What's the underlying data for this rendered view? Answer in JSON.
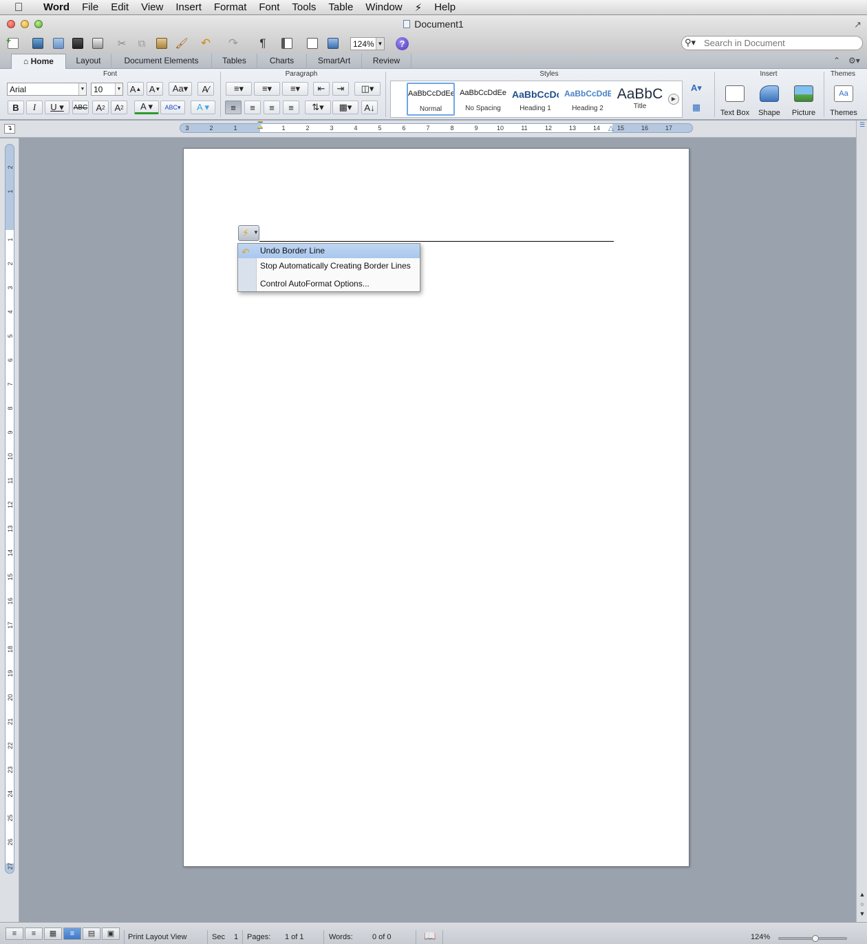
{
  "menubar": {
    "apple": "",
    "items": [
      "Word",
      "File",
      "Edit",
      "View",
      "Insert",
      "Format",
      "Font",
      "Tools",
      "Table",
      "Window",
      "Help"
    ]
  },
  "window": {
    "title": "Document1"
  },
  "toolbar": {
    "zoom": "124%",
    "search_placeholder": "Search in Document"
  },
  "ribbon_tabs": [
    "Home",
    "Layout",
    "Document Elements",
    "Tables",
    "Charts",
    "SmartArt",
    "Review"
  ],
  "ribbon": {
    "groups": {
      "font": "Font",
      "paragraph": "Paragraph",
      "styles": "Styles",
      "insert": "Insert",
      "themes": "Themes"
    },
    "font_name": "Arial",
    "font_size": "10",
    "styles": [
      {
        "sample": "AaBbCcDdEe",
        "label": "Normal"
      },
      {
        "sample": "AaBbCcDdEe",
        "label": "No Spacing"
      },
      {
        "sample": "AaBbCcDc",
        "label": "Heading 1"
      },
      {
        "sample": "AaBbCcDdEe",
        "label": "Heading 2"
      },
      {
        "sample": "AaBbC",
        "label": "Title"
      }
    ],
    "insert_buttons": [
      "Text Box",
      "Shape",
      "Picture"
    ],
    "themes_button": "Themes"
  },
  "ruler": {
    "h_labels": [
      "3",
      "2",
      "1",
      "1",
      "2",
      "3",
      "4",
      "5",
      "6",
      "7",
      "8",
      "9",
      "10",
      "11",
      "12",
      "13",
      "14",
      "15",
      "16",
      "17"
    ],
    "v_labels": [
      "2",
      "1",
      "1",
      "2",
      "3",
      "4",
      "5",
      "6",
      "7",
      "8",
      "9",
      "10",
      "11",
      "12",
      "13",
      "14",
      "15",
      "16",
      "17",
      "18",
      "19",
      "20",
      "21",
      "22",
      "23",
      "24",
      "25",
      "26",
      "27"
    ]
  },
  "autoformat_menu": {
    "items": [
      "Undo Border Line",
      "Stop Automatically Creating Border Lines",
      "Control AutoFormat Options..."
    ],
    "highlighted_index": 0
  },
  "statusbar": {
    "view": "Print Layout View",
    "sec_label": "Sec",
    "sec_value": "1",
    "pages_label": "Pages:",
    "pages_value": "1 of 1",
    "words_label": "Words:",
    "words_value": "0 of 0",
    "zoom": "124%",
    "zoom_level_percent": 124
  },
  "colors": {
    "canvas": "#9aa2ad",
    "page": "#ffffff",
    "menu_highlight": "#a9c7ee",
    "accent": "#3f79c6"
  }
}
